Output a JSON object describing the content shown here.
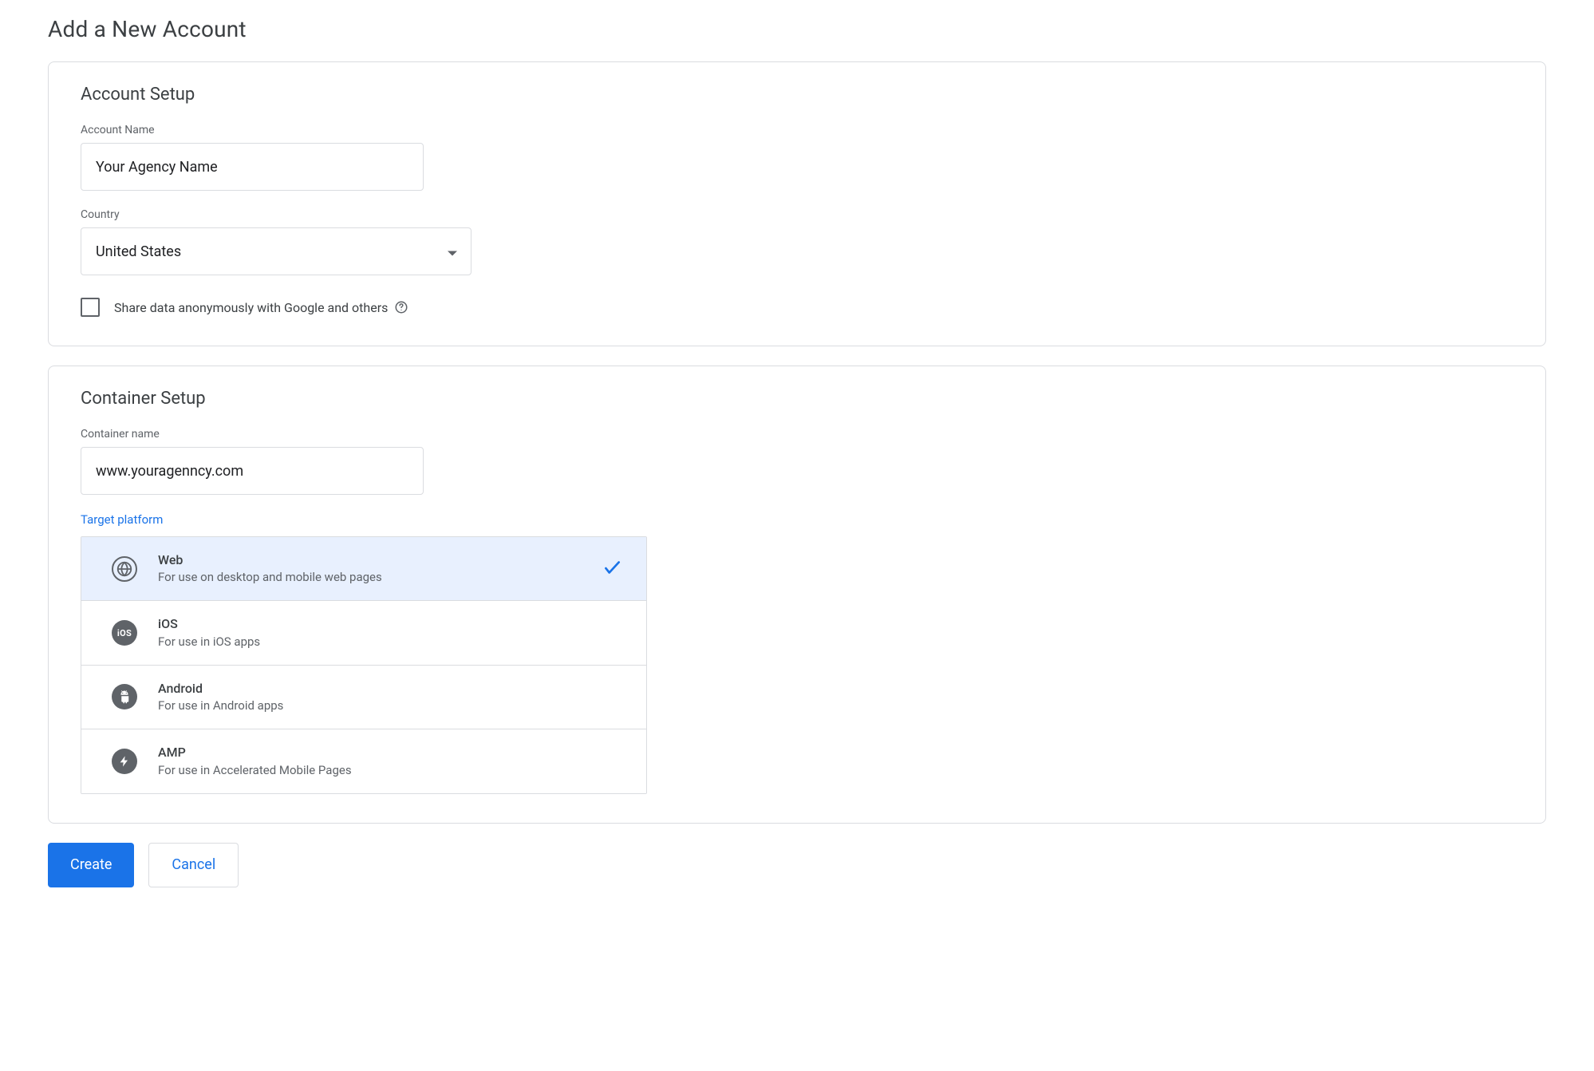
{
  "page": {
    "title": "Add a New Account"
  },
  "account_setup": {
    "title": "Account Setup",
    "name_label": "Account Name",
    "name_value": "Your Agency Name",
    "country_label": "Country",
    "country_value": "United States",
    "share_label": "Share data anonymously with Google and others"
  },
  "container_setup": {
    "title": "Container Setup",
    "name_label": "Container name",
    "name_value": "www.youragenncy.com",
    "platform_label": "Target platform",
    "platforms": [
      {
        "name": "Web",
        "desc": "For use on desktop and mobile web pages",
        "selected": true
      },
      {
        "name": "iOS",
        "desc": "For use in iOS apps",
        "selected": false
      },
      {
        "name": "Android",
        "desc": "For use in Android apps",
        "selected": false
      },
      {
        "name": "AMP",
        "desc": "For use in Accelerated Mobile Pages",
        "selected": false
      }
    ]
  },
  "buttons": {
    "create": "Create",
    "cancel": "Cancel"
  }
}
